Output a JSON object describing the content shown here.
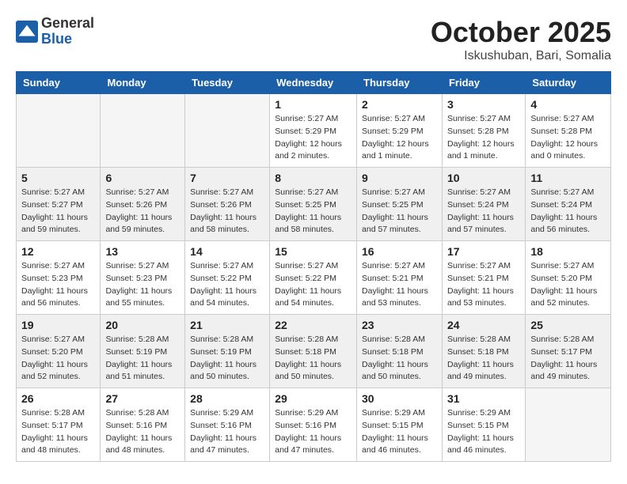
{
  "header": {
    "logo": {
      "general": "General",
      "blue": "Blue"
    },
    "title": "October 2025",
    "location": "Iskushuban, Bari, Somalia"
  },
  "calendar": {
    "weekdays": [
      "Sunday",
      "Monday",
      "Tuesday",
      "Wednesday",
      "Thursday",
      "Friday",
      "Saturday"
    ],
    "weeks": [
      [
        {
          "day": "",
          "info": ""
        },
        {
          "day": "",
          "info": ""
        },
        {
          "day": "",
          "info": ""
        },
        {
          "day": "1",
          "info": "Sunrise: 5:27 AM\nSunset: 5:29 PM\nDaylight: 12 hours\nand 2 minutes."
        },
        {
          "day": "2",
          "info": "Sunrise: 5:27 AM\nSunset: 5:29 PM\nDaylight: 12 hours\nand 1 minute."
        },
        {
          "day": "3",
          "info": "Sunrise: 5:27 AM\nSunset: 5:28 PM\nDaylight: 12 hours\nand 1 minute."
        },
        {
          "day": "4",
          "info": "Sunrise: 5:27 AM\nSunset: 5:28 PM\nDaylight: 12 hours\nand 0 minutes."
        }
      ],
      [
        {
          "day": "5",
          "info": "Sunrise: 5:27 AM\nSunset: 5:27 PM\nDaylight: 11 hours\nand 59 minutes."
        },
        {
          "day": "6",
          "info": "Sunrise: 5:27 AM\nSunset: 5:26 PM\nDaylight: 11 hours\nand 59 minutes."
        },
        {
          "day": "7",
          "info": "Sunrise: 5:27 AM\nSunset: 5:26 PM\nDaylight: 11 hours\nand 58 minutes."
        },
        {
          "day": "8",
          "info": "Sunrise: 5:27 AM\nSunset: 5:25 PM\nDaylight: 11 hours\nand 58 minutes."
        },
        {
          "day": "9",
          "info": "Sunrise: 5:27 AM\nSunset: 5:25 PM\nDaylight: 11 hours\nand 57 minutes."
        },
        {
          "day": "10",
          "info": "Sunrise: 5:27 AM\nSunset: 5:24 PM\nDaylight: 11 hours\nand 57 minutes."
        },
        {
          "day": "11",
          "info": "Sunrise: 5:27 AM\nSunset: 5:24 PM\nDaylight: 11 hours\nand 56 minutes."
        }
      ],
      [
        {
          "day": "12",
          "info": "Sunrise: 5:27 AM\nSunset: 5:23 PM\nDaylight: 11 hours\nand 56 minutes."
        },
        {
          "day": "13",
          "info": "Sunrise: 5:27 AM\nSunset: 5:23 PM\nDaylight: 11 hours\nand 55 minutes."
        },
        {
          "day": "14",
          "info": "Sunrise: 5:27 AM\nSunset: 5:22 PM\nDaylight: 11 hours\nand 54 minutes."
        },
        {
          "day": "15",
          "info": "Sunrise: 5:27 AM\nSunset: 5:22 PM\nDaylight: 11 hours\nand 54 minutes."
        },
        {
          "day": "16",
          "info": "Sunrise: 5:27 AM\nSunset: 5:21 PM\nDaylight: 11 hours\nand 53 minutes."
        },
        {
          "day": "17",
          "info": "Sunrise: 5:27 AM\nSunset: 5:21 PM\nDaylight: 11 hours\nand 53 minutes."
        },
        {
          "day": "18",
          "info": "Sunrise: 5:27 AM\nSunset: 5:20 PM\nDaylight: 11 hours\nand 52 minutes."
        }
      ],
      [
        {
          "day": "19",
          "info": "Sunrise: 5:27 AM\nSunset: 5:20 PM\nDaylight: 11 hours\nand 52 minutes."
        },
        {
          "day": "20",
          "info": "Sunrise: 5:28 AM\nSunset: 5:19 PM\nDaylight: 11 hours\nand 51 minutes."
        },
        {
          "day": "21",
          "info": "Sunrise: 5:28 AM\nSunset: 5:19 PM\nDaylight: 11 hours\nand 50 minutes."
        },
        {
          "day": "22",
          "info": "Sunrise: 5:28 AM\nSunset: 5:18 PM\nDaylight: 11 hours\nand 50 minutes."
        },
        {
          "day": "23",
          "info": "Sunrise: 5:28 AM\nSunset: 5:18 PM\nDaylight: 11 hours\nand 50 minutes."
        },
        {
          "day": "24",
          "info": "Sunrise: 5:28 AM\nSunset: 5:18 PM\nDaylight: 11 hours\nand 49 minutes."
        },
        {
          "day": "25",
          "info": "Sunrise: 5:28 AM\nSunset: 5:17 PM\nDaylight: 11 hours\nand 49 minutes."
        }
      ],
      [
        {
          "day": "26",
          "info": "Sunrise: 5:28 AM\nSunset: 5:17 PM\nDaylight: 11 hours\nand 48 minutes."
        },
        {
          "day": "27",
          "info": "Sunrise: 5:28 AM\nSunset: 5:16 PM\nDaylight: 11 hours\nand 48 minutes."
        },
        {
          "day": "28",
          "info": "Sunrise: 5:29 AM\nSunset: 5:16 PM\nDaylight: 11 hours\nand 47 minutes."
        },
        {
          "day": "29",
          "info": "Sunrise: 5:29 AM\nSunset: 5:16 PM\nDaylight: 11 hours\nand 47 minutes."
        },
        {
          "day": "30",
          "info": "Sunrise: 5:29 AM\nSunset: 5:15 PM\nDaylight: 11 hours\nand 46 minutes."
        },
        {
          "day": "31",
          "info": "Sunrise: 5:29 AM\nSunset: 5:15 PM\nDaylight: 11 hours\nand 46 minutes."
        },
        {
          "day": "",
          "info": ""
        }
      ]
    ]
  }
}
